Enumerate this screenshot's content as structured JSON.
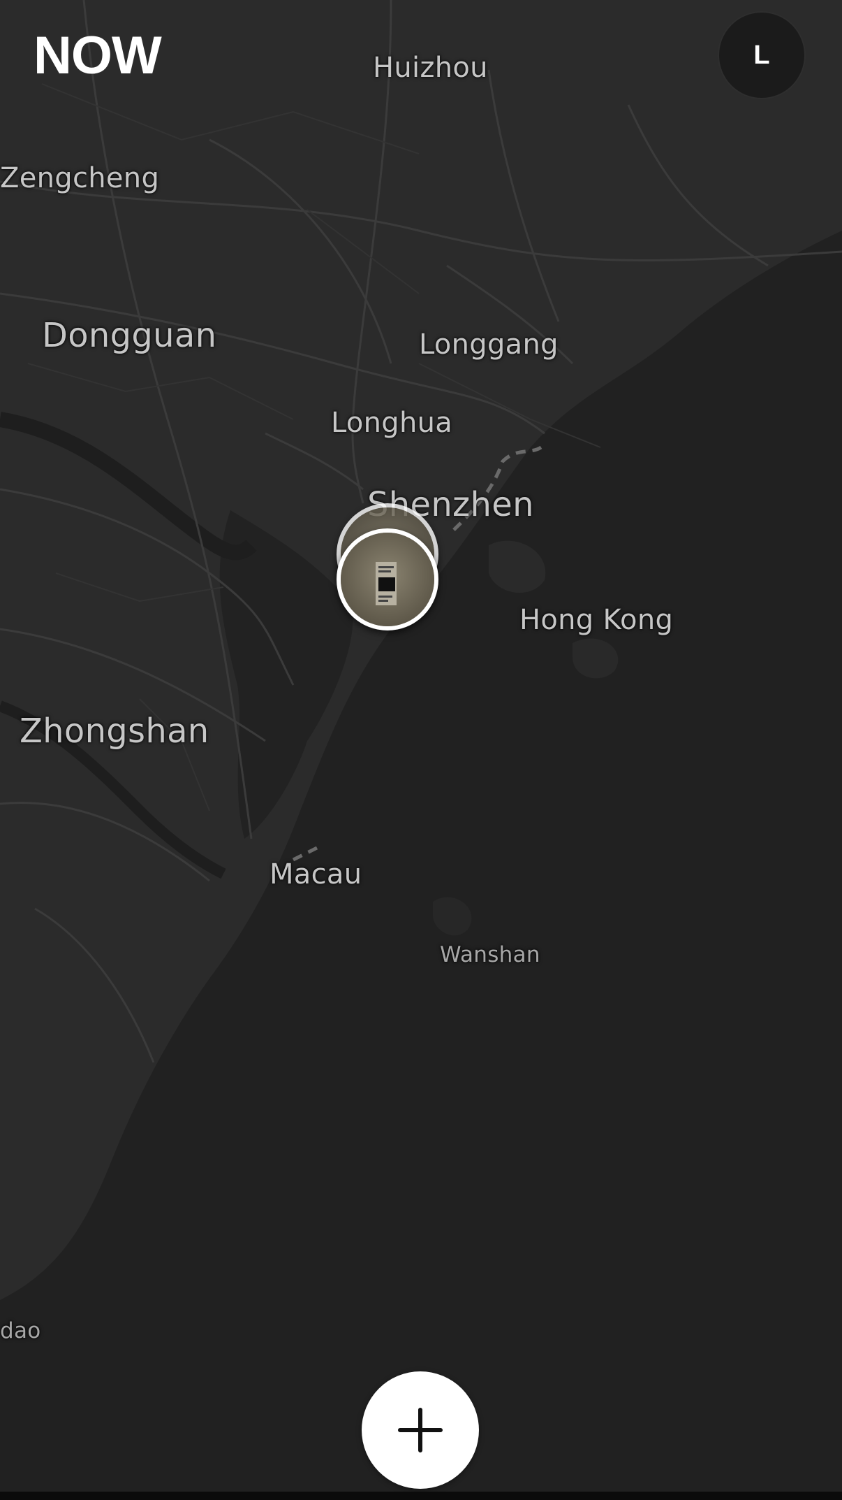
{
  "app": {
    "title": "NOW"
  },
  "profile": {
    "initial": "L"
  },
  "map": {
    "places": {
      "huizhou": "Huizhou",
      "zengcheng": "Zengcheng",
      "dongguan": "Dongguan",
      "longgang": "Longgang",
      "longhua": "Longhua",
      "shenzhen": "Shenzhen",
      "hong_kong": "Hong Kong",
      "zhongshan": "Zhongshan",
      "macau": "Macau",
      "wanshan": "Wanshan",
      "dao_fragment": "dao"
    },
    "markers": [
      {
        "type": "photo-cluster",
        "count": 2
      }
    ]
  },
  "actions": {
    "add": "plus-icon"
  }
}
